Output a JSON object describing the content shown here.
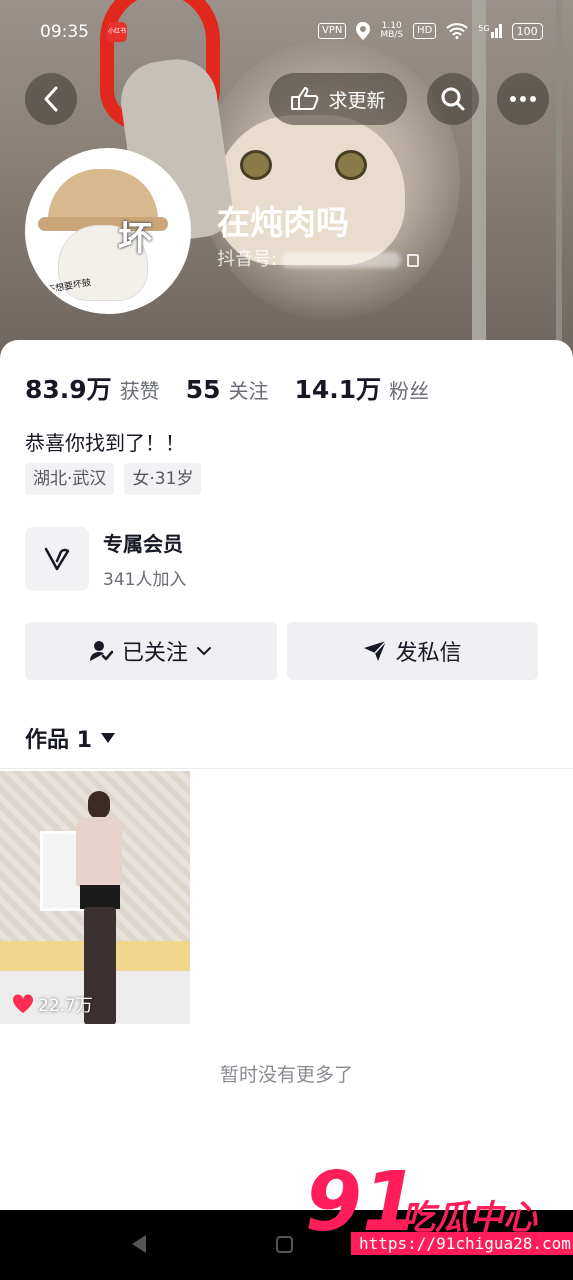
{
  "status_bar": {
    "time": "09:35",
    "app_icon_text": "小红书",
    "vpn": "VPN",
    "speed_value": "1.10",
    "speed_unit": "MB/S",
    "hd": "HD",
    "network": "5G",
    "battery": "100"
  },
  "nav": {
    "update_label": "求更新"
  },
  "avatar": {
    "text": "坏",
    "sub_text": "不想要坏鼓"
  },
  "profile": {
    "nickname": "在炖肉吗",
    "douyin_id_label": "抖音号:"
  },
  "stats": [
    {
      "value": "83.9万",
      "label": "获赞"
    },
    {
      "value": "55",
      "label": "关注"
    },
    {
      "value": "14.1万",
      "label": "粉丝"
    }
  ],
  "bio": "恭喜你找到了！！",
  "tags": [
    "湖北·武汉",
    "女·31岁"
  ],
  "member": {
    "title": "专属会员",
    "subtitle": "341人加入"
  },
  "actions": {
    "follow_label": "已关注",
    "message_label": "发私信"
  },
  "works": {
    "tab_label": "作品 1",
    "videos": [
      {
        "likes": "22.7万"
      }
    ]
  },
  "no_more_text": "暂时没有更多了",
  "watermark": {
    "number": "91",
    "text": "吃瓜中心",
    "url": "https://91chigua28.com"
  },
  "colors": {
    "accent": "#ff1e5a",
    "text_primary": "#161823",
    "text_secondary": "#6b6d76",
    "button_bg": "#f0f0f2"
  }
}
